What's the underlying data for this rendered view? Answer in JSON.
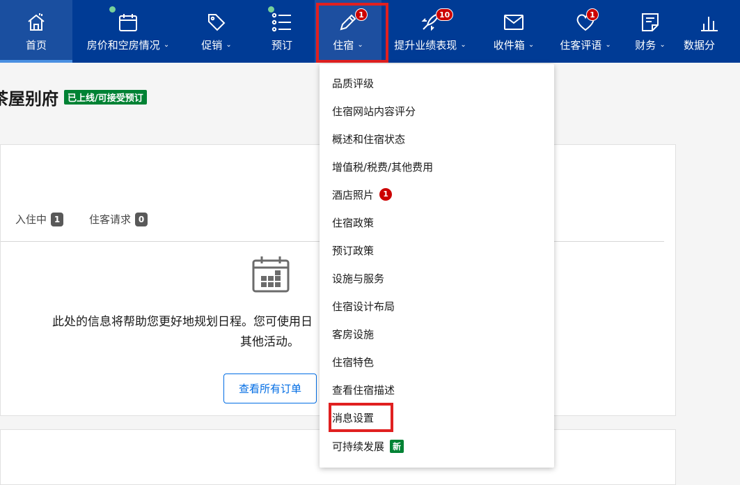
{
  "nav": {
    "home": "首页",
    "rates": "房价和空房情况",
    "promotions": "促销",
    "reservations": "预订",
    "property": "住宿",
    "property_badge": "1",
    "boost": "提升业绩表现",
    "boost_badge": "10",
    "inbox": "收件箱",
    "reviews": "住客评语",
    "reviews_badge": "1",
    "finance": "财务",
    "analytics": "数据分"
  },
  "header": {
    "title": "茶屋别府",
    "status": "已上线/可接受预订"
  },
  "tabs": {
    "checking_in": "入住中",
    "checking_in_count": "1",
    "guest_requests": "住客请求",
    "guest_requests_count": "0"
  },
  "empty_state": {
    "line1": "此处的信息将帮助您更好地规划日程。您可使用日",
    "line2": "其他活动。",
    "button": "查看所有订单"
  },
  "dropdown": {
    "items": [
      "品质评级",
      "住宿网站内容评分",
      "概述和住宿状态",
      "增值税/税费/其他费用",
      "酒店照片",
      "住宿政策",
      "预订政策",
      "设施与服务",
      "住宿设计布局",
      "客房设施",
      "住宿特色",
      "查看住宿描述",
      "消息设置",
      "可持续发展"
    ],
    "photos_badge": "1",
    "new_badge": "新"
  },
  "colors": {
    "nav_bg": "#003b95",
    "highlight": "#e02020",
    "status_green": "#008234",
    "badge_red": "#cc0000",
    "link_blue": "#006ce4"
  }
}
